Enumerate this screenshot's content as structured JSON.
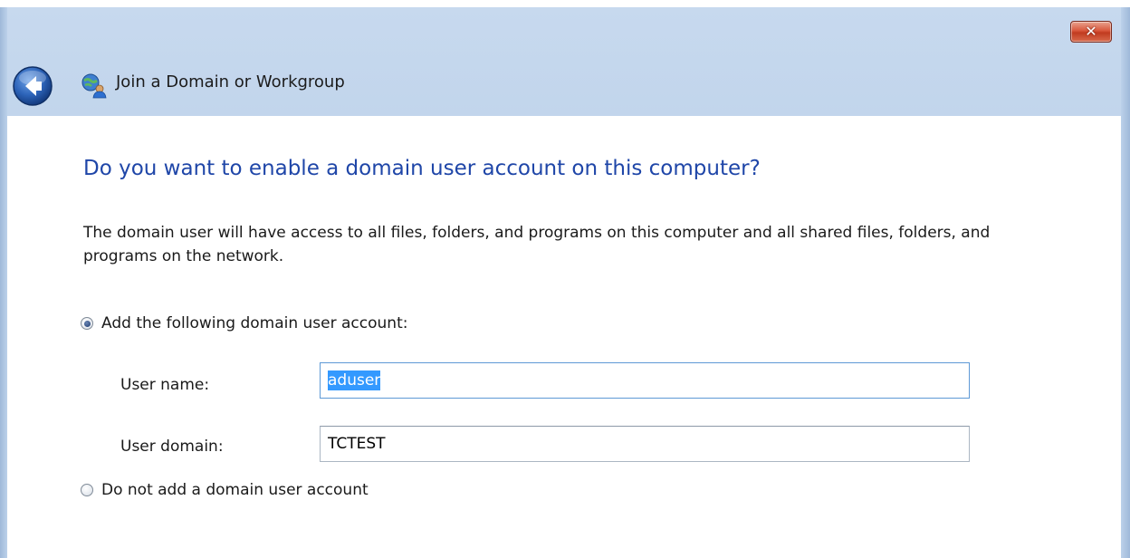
{
  "window": {
    "title": "Join a Domain or Workgroup",
    "close_glyph": "✕",
    "icons": {
      "back": "back-arrow-icon",
      "network": "network-icon",
      "close": "close-icon"
    }
  },
  "page": {
    "heading": "Do you want to enable a domain user account on this computer?",
    "description": "The domain user will have access to all files, folders, and programs on this computer and all shared files, folders, and programs on the network."
  },
  "options": {
    "add_account": {
      "label": "Add the following domain user account:",
      "selected": true
    },
    "do_not_add": {
      "label": "Do not add a domain user account",
      "selected": false
    }
  },
  "form": {
    "user_name": {
      "label": "User name:",
      "value": "aduser",
      "text_selected": true
    },
    "user_domain": {
      "label": "User domain:",
      "value": "TCTEST"
    }
  },
  "colors": {
    "heading": "#1f46a8",
    "selection": "#3399ff",
    "frame": "#bcd1ea"
  }
}
